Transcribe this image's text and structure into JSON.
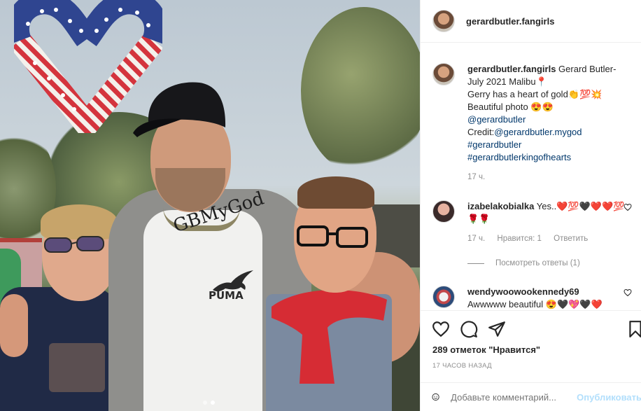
{
  "post": {
    "author": "gerardbutler.fangirls",
    "photo_watermark": "GBMyGod",
    "shirt_brand": "PUMA",
    "caption": {
      "line1": "Gerard Butler-",
      "line2": "July 2021 Malibu",
      "line3": "Gerry has a heart of gold",
      "line3_emoji": "👏💯💥",
      "line4": "Beautiful photo",
      "line4_emoji": "😍😍",
      "mention": "@gerardbutler",
      "credit_label": "Credit:",
      "credit_mention": "@gerardbutler.mygod",
      "hashtag1": "#gerardbutler",
      "hashtag2": "#gerardbutlerkingofhearts",
      "pin_emoji": "📍",
      "time": "17 ч."
    }
  },
  "comments": [
    {
      "user": "izabelakobialka",
      "text": "Yes..",
      "emoji": "❤️💯🖤❤️❤️💯🌹🌹",
      "time": "17 ч.",
      "likes": "Нравится: 1",
      "reply": "Ответить",
      "view_replies": "Посмотреть ответы (1)"
    },
    {
      "user": "wendywoowookennedy69",
      "text": "Awwwww beautiful",
      "emoji": "😍🖤💖🖤❤️"
    }
  ],
  "likes_text": "289 отметок \"Нравится\"",
  "timestamp": "17 ЧАСОВ НАЗАД",
  "comment_box": {
    "placeholder": "Добавьте комментарий...",
    "publish": "Опубликовать"
  },
  "icons": [
    "heart-icon",
    "comment-icon",
    "share-icon",
    "bookmark-icon",
    "emoji-icon"
  ],
  "colors": {
    "link": "#00376b",
    "muted": "#8e8e8e",
    "publish": "#b2dffc"
  }
}
